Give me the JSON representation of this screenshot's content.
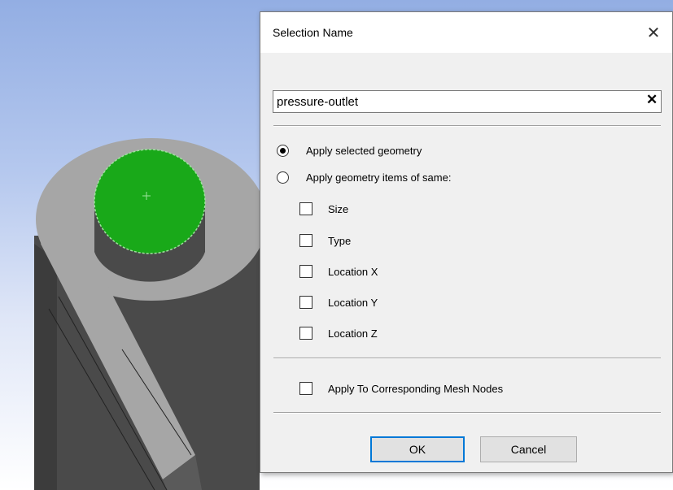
{
  "dialog": {
    "title": "Selection Name",
    "close_icon": "close-icon",
    "name_value": "pressure-outlet",
    "clear_icon": "clear-icon",
    "radio_selected_label": "Apply selected geometry",
    "radio_same_label": "Apply geometry items of same:",
    "selected_option": "Apply selected geometry",
    "checkboxes": [
      "Size",
      "Type",
      "Location X",
      "Location Y",
      "Location Z"
    ],
    "mesh_nodes_label": "Apply To Corresponding Mesh Nodes",
    "ok_label": "OK",
    "cancel_label": "Cancel"
  },
  "viewport": {
    "background_top": "#93aee3",
    "body_color": "#4a4a4a",
    "top_face_color": "#a6a6a6",
    "selected_face_color": "#19a919"
  }
}
